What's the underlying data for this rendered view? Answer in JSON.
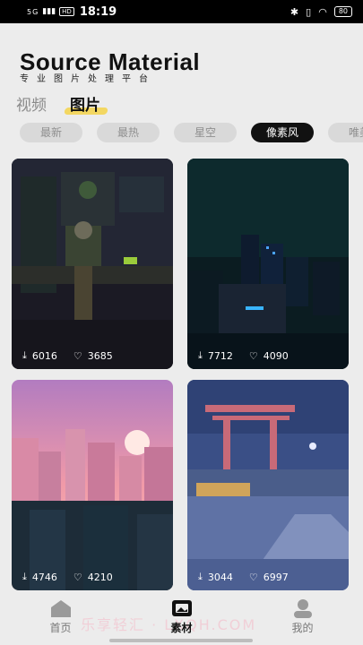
{
  "status_bar": {
    "signal": "5G",
    "network": "HD",
    "time": "18:19",
    "icons": [
      "bluetooth-icon",
      "vibrate-icon",
      "wifi-icon"
    ],
    "battery": "80"
  },
  "header": {
    "title": "Source Material",
    "subtitle": "专业图片处理平台"
  },
  "media_tabs": [
    {
      "label": "视频",
      "active": false
    },
    {
      "label": "图片",
      "active": true
    }
  ],
  "categories": [
    {
      "label": "最新",
      "active": false
    },
    {
      "label": "最热",
      "active": false
    },
    {
      "label": "星空",
      "active": false
    },
    {
      "label": "像素风",
      "active": true
    },
    {
      "label": "唯美",
      "active": false
    }
  ],
  "cards": [
    {
      "downloads": "6016",
      "likes": "3685",
      "theme": "pixel-room"
    },
    {
      "downloads": "7712",
      "likes": "4090",
      "theme": "pixel-night-city"
    },
    {
      "downloads": "4746",
      "likes": "4210",
      "theme": "pixel-sunset-city"
    },
    {
      "downloads": "3044",
      "likes": "6997",
      "theme": "pixel-shrine"
    }
  ],
  "bottom_nav": [
    {
      "label": "首页",
      "icon": "home-icon",
      "active": false
    },
    {
      "label": "素材",
      "icon": "gallery-icon",
      "active": true
    },
    {
      "label": "我的",
      "icon": "user-icon",
      "active": false
    }
  ],
  "watermark": "乐享轻汇 · LXQH.COM",
  "colors": {
    "accent": "#f5d44a",
    "active_chip": "#111111",
    "chip": "#d9d9d9"
  }
}
